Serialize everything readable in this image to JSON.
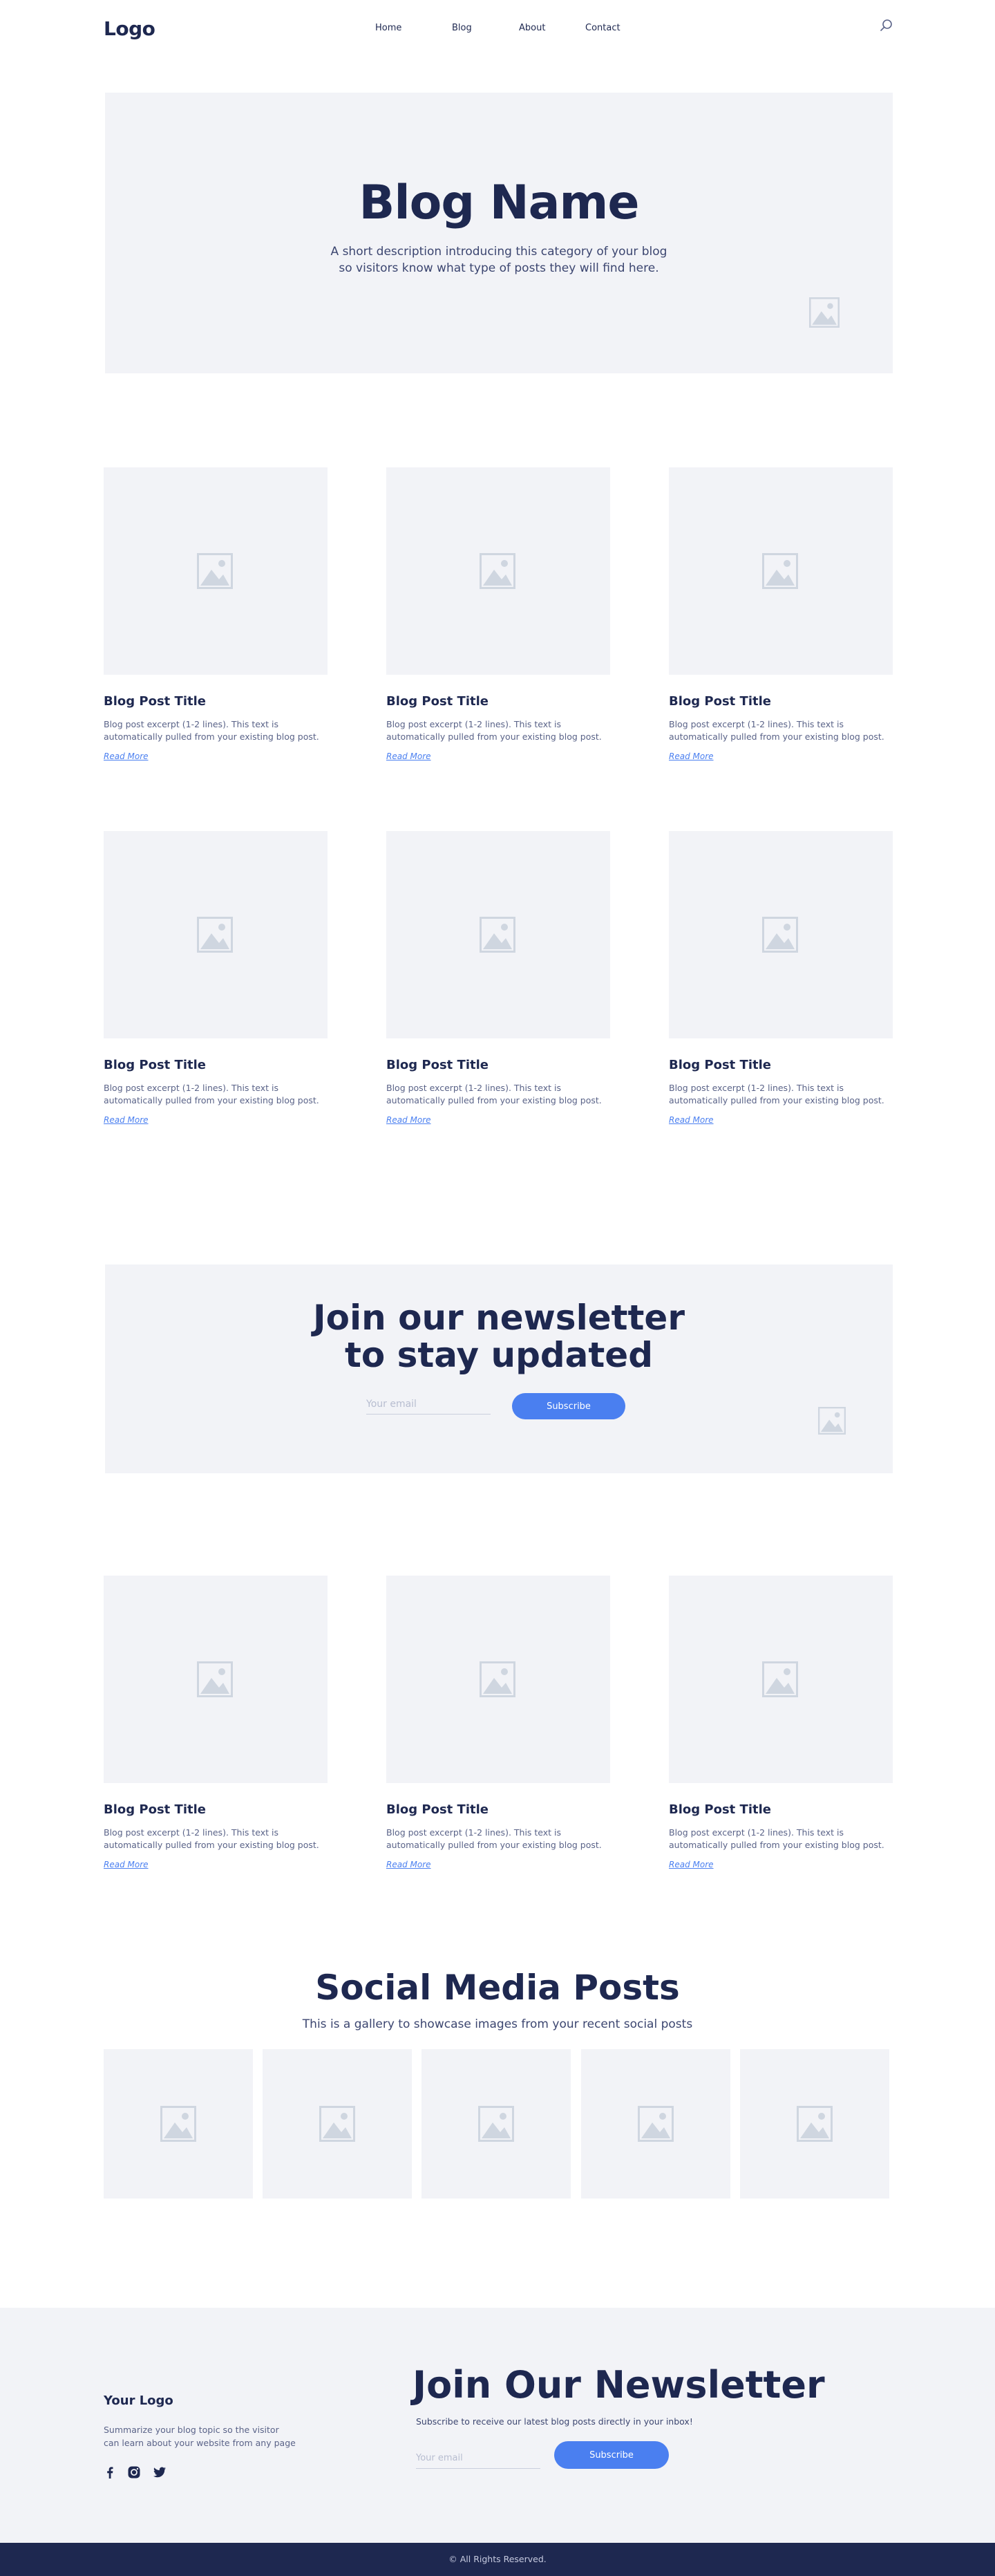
{
  "header": {
    "logo": "Logo",
    "nav": [
      "Home",
      "Blog",
      "About",
      "Contact"
    ],
    "search_icon": "search-icon"
  },
  "hero": {
    "title": "Blog Name",
    "description": "A short description introducing this category of your blog so visitors know what type of posts they will find here.",
    "image_icon": "image-placeholder-icon"
  },
  "posts": [
    {
      "title": "Blog Post Title",
      "excerpt": "Blog post excerpt (1-2 lines). This text is automatically pulled from your existing blog post.",
      "link": "Read More"
    },
    {
      "title": "Blog Post Title",
      "excerpt": "Blog post excerpt (1-2 lines). This text is automatically pulled from your existing blog post.",
      "link": "Read More"
    },
    {
      "title": "Blog Post Title",
      "excerpt": "Blog post excerpt (1-2 lines). This text is automatically pulled from your existing blog post.",
      "link": "Read More"
    },
    {
      "title": "Blog Post Title",
      "excerpt": "Blog post excerpt (1-2 lines). This text is automatically pulled from your existing blog post.",
      "link": "Read More"
    },
    {
      "title": "Blog Post Title",
      "excerpt": "Blog post excerpt (1-2 lines). This text is automatically pulled from your existing blog post.",
      "link": "Read More"
    },
    {
      "title": "Blog Post Title",
      "excerpt": "Blog post excerpt (1-2 lines). This text is automatically pulled from your existing blog post.",
      "link": "Read More"
    },
    {
      "title": "Blog Post Title",
      "excerpt": "Blog post excerpt (1-2 lines). This text is automatically pulled from your existing blog post.",
      "link": "Read More"
    },
    {
      "title": "Blog Post Title",
      "excerpt": "Blog post excerpt (1-2 lines). This text is automatically pulled from your existing blog post.",
      "link": "Read More"
    },
    {
      "title": "Blog Post Title",
      "excerpt": "Blog post excerpt (1-2 lines). This text is automatically pulled from your existing blog post.",
      "link": "Read More"
    }
  ],
  "newsletter": {
    "title_line1": "Join our newsletter",
    "title_line2": "to stay updated",
    "email_placeholder": "Your email",
    "button": "Subscribe"
  },
  "social": {
    "title": "Social Media Posts",
    "subtitle": "This is a gallery to showcase images from your recent social posts"
  },
  "footer": {
    "logo": "Your Logo",
    "description": "Summarize your blog topic so the visitor can learn about your website from any page",
    "social_icons": [
      "facebook-icon",
      "instagram-icon",
      "twitter-icon"
    ],
    "newsletter_title": "Join Our Newsletter",
    "newsletter_sub": "Subscribe to receive our latest blog posts directly in your inbox!",
    "email_placeholder": "Your email",
    "button": "Subscribe",
    "copyright": "© All Rights Reserved."
  },
  "colors": {
    "navy": "#1e2850",
    "accent": "#4a7ff0",
    "panel": "#f2f3f7",
    "icon": "#cfd6e0"
  }
}
